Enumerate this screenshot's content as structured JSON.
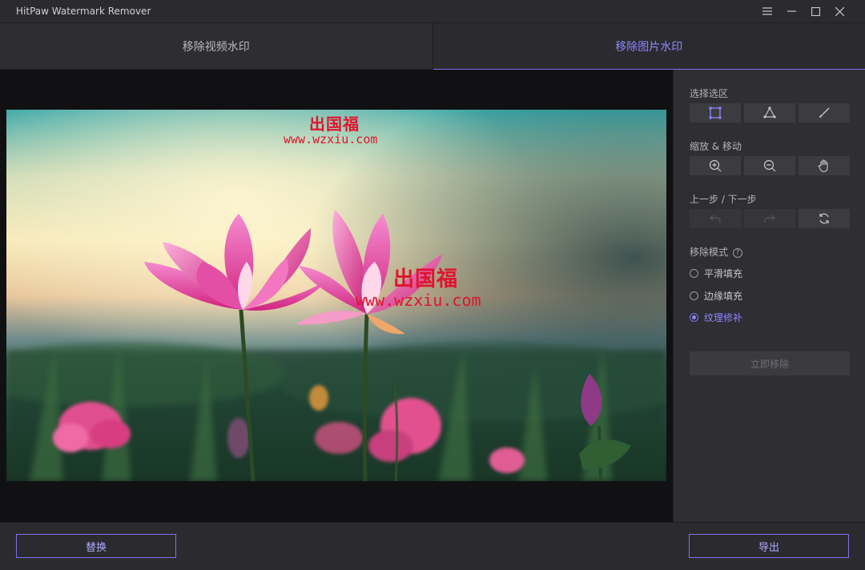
{
  "app": {
    "title": "HitPaw Watermark Remover"
  },
  "window_controls": {
    "menu_icon": "menu-icon",
    "minimize_icon": "minimize-icon",
    "maximize_icon": "maximize-icon",
    "close_icon": "close-icon"
  },
  "tabs": [
    {
      "label": "移除视频水印",
      "active": false
    },
    {
      "label": "移除图片水印",
      "active": true
    }
  ],
  "image": {
    "subject": "pink lotus flowers at sunset",
    "watermarks": [
      {
        "logo": "出国福",
        "url": "www.wzxiu.com"
      },
      {
        "logo": "出国福",
        "url": "www.wzxiu.com"
      }
    ]
  },
  "panel": {
    "selection": {
      "title": "选择选区",
      "tools": [
        "rectangle-select-icon",
        "polygon-select-icon",
        "brush-icon"
      ]
    },
    "zoom": {
      "title": "缩放 & 移动",
      "tools": [
        "zoom-in-icon",
        "zoom-out-icon",
        "hand-icon"
      ]
    },
    "history": {
      "title": "上一步 / 下一步",
      "tools": [
        "undo-icon",
        "redo-icon",
        "reset-icon"
      ]
    },
    "mode": {
      "title": "移除模式",
      "options": [
        {
          "label": "平滑填充",
          "selected": false
        },
        {
          "label": "边缘填充",
          "selected": false
        },
        {
          "label": "纹理修补",
          "selected": true
        }
      ]
    },
    "remove_button": "立即移除"
  },
  "bottom": {
    "replace_button": "替换",
    "export_button": "导出"
  },
  "colors": {
    "accent": "#8f85ff",
    "watermark": "#e0142d",
    "background": "#2b2b2f"
  }
}
